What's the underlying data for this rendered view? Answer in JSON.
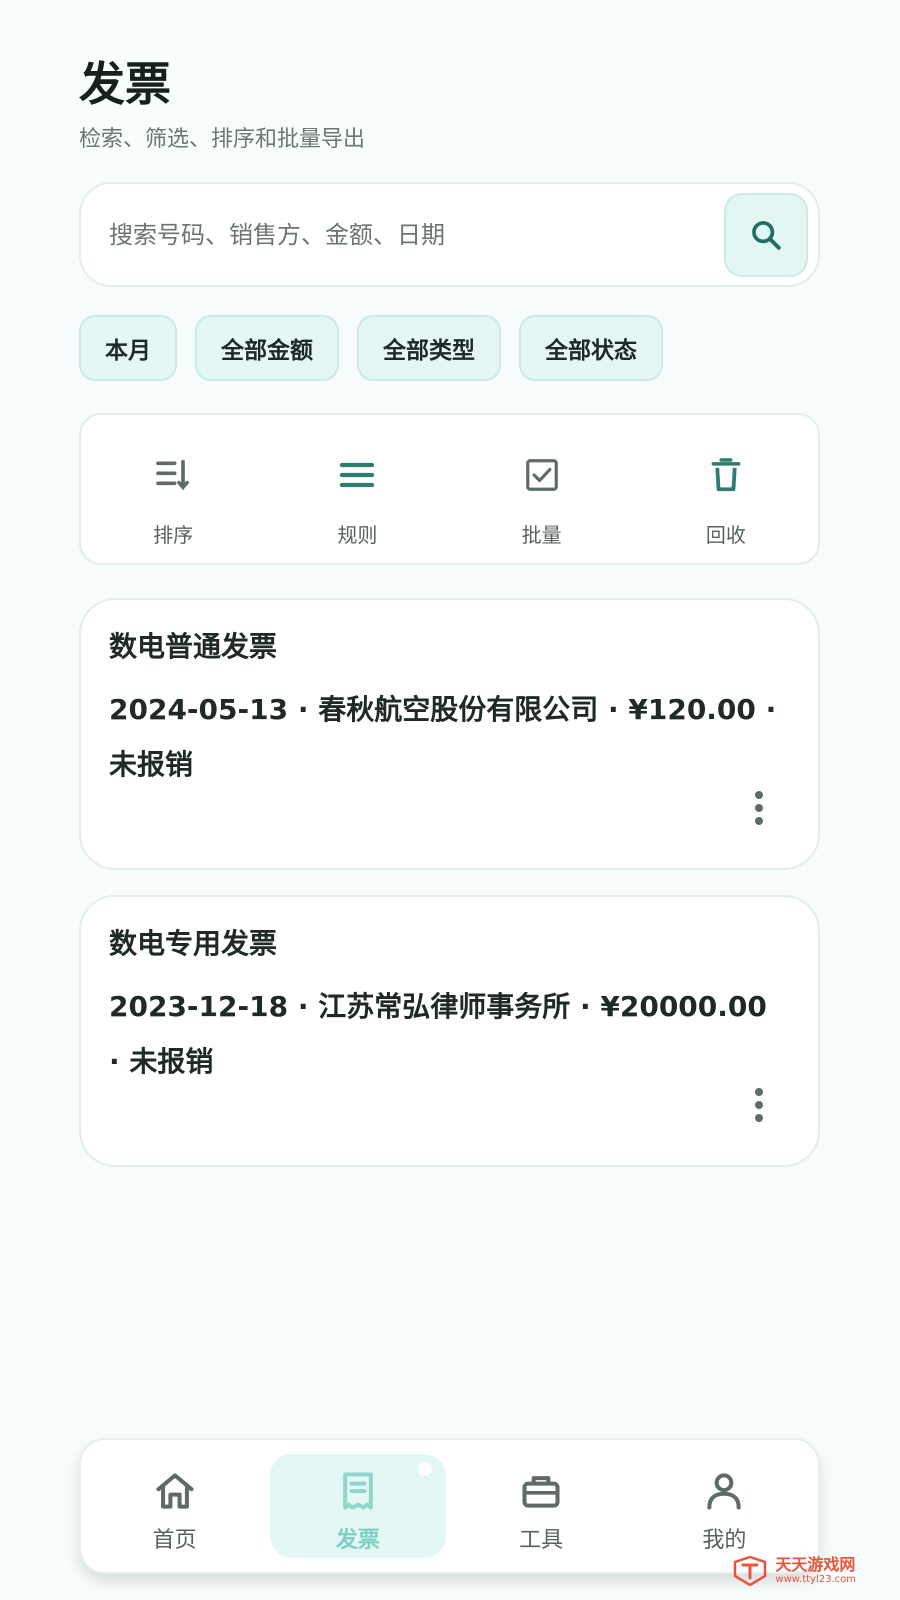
{
  "header": {
    "title": "发票",
    "subtitle": "检索、筛选、排序和批量导出"
  },
  "search": {
    "placeholder": "搜索号码、销售方、金额、日期",
    "icon": "search-icon"
  },
  "filters": [
    {
      "label": "本月"
    },
    {
      "label": "全部金额"
    },
    {
      "label": "全部类型"
    },
    {
      "label": "全部状态"
    }
  ],
  "toolbar": [
    {
      "label": "排序",
      "icon": "sort-icon"
    },
    {
      "label": "规则",
      "icon": "menu-lines-icon"
    },
    {
      "label": "批量",
      "icon": "checkbox-icon"
    },
    {
      "label": "回收",
      "icon": "trash-icon"
    }
  ],
  "invoices": [
    {
      "type": "数电普通发票",
      "date": "2024-05-13",
      "seller": "春秋航空股份有限公司",
      "amount": "¥120.00",
      "status": "未报销",
      "separator": " · ",
      "meta": "2024-05-13 · 春秋航空股份有限公司 · ¥120.00 · 未报销"
    },
    {
      "type": "数电专用发票",
      "date": "2023-12-18",
      "seller": "江苏常弘律师事务所",
      "amount": "¥20000.00",
      "status": "未报销",
      "separator": " · ",
      "meta": "2023-12-18 · 江苏常弘律师事务所 · ¥20000.00 · 未报销"
    }
  ],
  "bottom_nav": [
    {
      "label": "首页",
      "icon": "home-icon",
      "active": false
    },
    {
      "label": "发票",
      "icon": "receipt-icon",
      "active": true
    },
    {
      "label": "工具",
      "icon": "toolbox-icon",
      "active": false
    },
    {
      "label": "我的",
      "icon": "user-icon",
      "active": false
    }
  ],
  "watermark": {
    "name": "天天游戏网",
    "url": "www.ttyl23.com"
  },
  "colors": {
    "accent": "#2e7d72",
    "accent_light": "#e3f8f5",
    "background": "#f7fcfc",
    "active_label": "#7fcfc3"
  }
}
